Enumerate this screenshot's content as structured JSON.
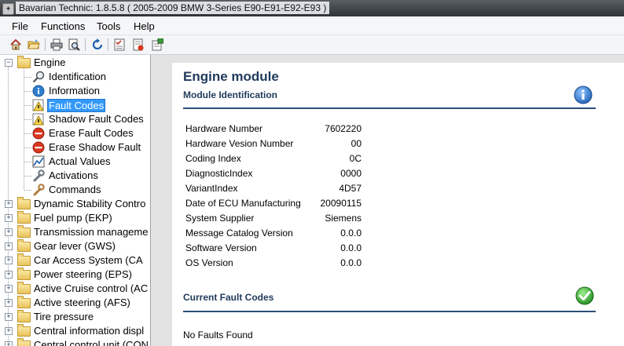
{
  "window": {
    "title": "Bavarian Technic: 1.8.5.8  ( 2005-2009 BMW 3-Series E90-E91-E92-E93 )"
  },
  "menu": [
    "File",
    "Functions",
    "Tools",
    "Help"
  ],
  "toolbar": [
    "home-icon",
    "open-folder-icon",
    "print-icon",
    "print-preview-icon",
    "refresh-icon",
    "checklist-icon",
    "report-icon",
    "settings-report-icon"
  ],
  "tree": {
    "root": "Engine",
    "children": [
      "Identification",
      "Information",
      "Fault Codes",
      "Shadow Fault Codes",
      "Erase Fault Codes",
      "Erase Shadow Fault",
      "Actual Values",
      "Activations",
      "Commands"
    ],
    "selected": "Fault Codes",
    "modules": [
      "Dynamic Stability Contro",
      "Fuel pump (EKP)",
      "Transmission manageme",
      "Gear lever (GWS)",
      "Car Access System (CA",
      "Power steering (EPS)",
      "Active Cruise control (AC",
      "Active steering (AFS)",
      "Tire pressure",
      "Central information displ",
      "Central control unit (CON"
    ]
  },
  "content": {
    "title": "Engine module",
    "section1": "Module Identification",
    "fields": [
      {
        "label": "Hardware Number",
        "value": "7602220"
      },
      {
        "label": "Hardware Vesion Number",
        "value": "00"
      },
      {
        "label": "Coding Index",
        "value": "0C"
      },
      {
        "label": "DiagnosticIndex",
        "value": "0000"
      },
      {
        "label": "VariantIndex",
        "value": "4D57"
      },
      {
        "label": "Date of ECU Manufacturing",
        "value": "20090115"
      },
      {
        "label": "System Supplier",
        "value": "Siemens"
      },
      {
        "label": "Message Catalog Version",
        "value": "0.0.0"
      },
      {
        "label": "Software Version",
        "value": "0.0.0"
      },
      {
        "label": "OS Version",
        "value": "0.0.0"
      }
    ],
    "section2": "Current Fault Codes",
    "status": "No Faults Found"
  },
  "colors": {
    "heading": "#1f3a5a",
    "selection": "#3399ff",
    "info": "#2f7fd1",
    "ok": "#2eaa2e"
  }
}
